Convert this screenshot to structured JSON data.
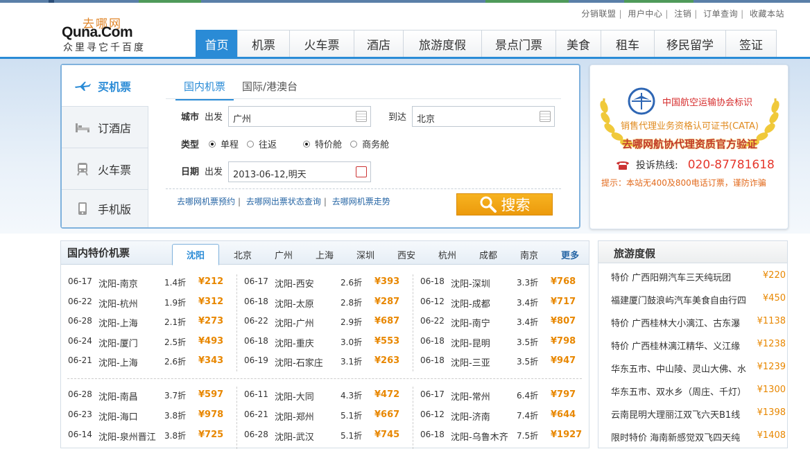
{
  "top_links": [
    "分销联盟",
    "用户中心",
    "注销",
    "订单查询",
    "收藏本站"
  ],
  "logo": {
    "cn": "去哪网",
    "en": "Quna.Com",
    "slogan": "众里寻它千百度"
  },
  "nav": [
    "首页",
    "机票",
    "火车票",
    "酒店",
    "旅游度假",
    "景点门票",
    "美食",
    "租车",
    "移民留学",
    "签证"
  ],
  "side_tabs": [
    {
      "label": "买机票",
      "icon": "airplane-icon"
    },
    {
      "label": "订酒店",
      "icon": "bed-icon"
    },
    {
      "label": "火车票",
      "icon": "train-icon"
    },
    {
      "label": "手机版",
      "icon": "mobile-icon"
    }
  ],
  "search": {
    "tabs": [
      "国内机票",
      "国际/港澳台"
    ],
    "city_label": "城市",
    "depart_label": "出发",
    "depart_value": "广州",
    "arrive_label": "到达",
    "arrive_value": "北京",
    "type_label": "类型",
    "trip_options": [
      "单程",
      "往返"
    ],
    "cabin_options": [
      "特价舱",
      "商务舱"
    ],
    "date_label": "日期",
    "date_depart_label": "出发",
    "date_value": "2013-06-12,明天",
    "quick_links": [
      "去哪网机票预约",
      "去哪网出票状态查询",
      "去哪网机票走势"
    ],
    "button": "搜索"
  },
  "cata": {
    "line1": "中国航空运输协会标识",
    "line2": "销售代理业务资格认可证书(CATA)",
    "line3": "去哪网航协代理资质官方验证",
    "hotline_label": "投诉热线:",
    "hotline_number": "020-87781618",
    "warning": "提示：本站无400及800电话订票，谨防诈骗"
  },
  "deals_panel": {
    "title": "国内特价机票",
    "cities": [
      "沈阳",
      "北京",
      "广州",
      "上海",
      "深圳",
      "西安",
      "杭州",
      "成都",
      "南京"
    ],
    "more": "更多",
    "columns": [
      [
        {
          "date": "06-17",
          "route": "沈阳-南京",
          "discount": "1.4折",
          "price": "¥212"
        },
        {
          "date": "06-22",
          "route": "沈阳-杭州",
          "discount": "1.9折",
          "price": "¥312"
        },
        {
          "date": "06-28",
          "route": "沈阳-上海",
          "discount": "2.1折",
          "price": "¥273"
        },
        {
          "date": "06-24",
          "route": "沈阳-厦门",
          "discount": "2.5折",
          "price": "¥493"
        },
        {
          "date": "06-21",
          "route": "沈阳-上海",
          "discount": "2.6折",
          "price": "¥343"
        },
        {
          "date": "06-28",
          "route": "沈阳-南昌",
          "discount": "3.7折",
          "price": "¥597"
        },
        {
          "date": "06-23",
          "route": "沈阳-海口",
          "discount": "3.8折",
          "price": "¥978"
        },
        {
          "date": "06-14",
          "route": "沈阳-泉州晋江",
          "discount": "3.8折",
          "price": "¥725"
        }
      ],
      [
        {
          "date": "06-17",
          "route": "沈阳-西安",
          "discount": "2.6折",
          "price": "¥393"
        },
        {
          "date": "06-18",
          "route": "沈阳-太原",
          "discount": "2.8折",
          "price": "¥287"
        },
        {
          "date": "06-22",
          "route": "沈阳-广州",
          "discount": "2.9折",
          "price": "¥687"
        },
        {
          "date": "06-18",
          "route": "沈阳-重庆",
          "discount": "3.0折",
          "price": "¥553"
        },
        {
          "date": "06-19",
          "route": "沈阳-石家庄",
          "discount": "3.1折",
          "price": "¥263"
        },
        {
          "date": "06-11",
          "route": "沈阳-大同",
          "discount": "4.3折",
          "price": "¥472"
        },
        {
          "date": "06-21",
          "route": "沈阳-郑州",
          "discount": "5.1折",
          "price": "¥667"
        },
        {
          "date": "06-28",
          "route": "沈阳-武汉",
          "discount": "5.1折",
          "price": "¥745"
        }
      ],
      [
        {
          "date": "06-18",
          "route": "沈阳-深圳",
          "discount": "3.3折",
          "price": "¥768"
        },
        {
          "date": "06-12",
          "route": "沈阳-成都",
          "discount": "3.4折",
          "price": "¥717"
        },
        {
          "date": "06-22",
          "route": "沈阳-南宁",
          "discount": "3.4折",
          "price": "¥807"
        },
        {
          "date": "06-18",
          "route": "沈阳-昆明",
          "discount": "3.5折",
          "price": "¥798"
        },
        {
          "date": "06-18",
          "route": "沈阳-三亚",
          "discount": "3.5折",
          "price": "¥947"
        },
        {
          "date": "06-17",
          "route": "沈阳-常州",
          "discount": "6.4折",
          "price": "¥797"
        },
        {
          "date": "06-12",
          "route": "沈阳-济南",
          "discount": "7.4折",
          "price": "¥644"
        },
        {
          "date": "06-18",
          "route": "沈阳-乌鲁木齐",
          "discount": "7.5折",
          "price": "¥1927"
        }
      ]
    ]
  },
  "travel": {
    "title": "旅游度假",
    "items": [
      {
        "name": "特价 广西阳朔汽车三天纯玩团",
        "price": "¥220"
      },
      {
        "name": "福建厦门鼓浪屿汽车美食自由行四",
        "price": "¥450"
      },
      {
        "name": "特价 广西桂林大小漓江、古东瀑",
        "price": "¥1138"
      },
      {
        "name": "特价 广西桂林漓江精华、义江缘",
        "price": "¥1238"
      },
      {
        "name": "华东五市、中山陵、灵山大佛、水",
        "price": "¥1239"
      },
      {
        "name": "华东五市、双水乡（周庄、千灯）",
        "price": "¥1300"
      },
      {
        "name": "云南昆明大理丽江双飞六天B1线",
        "price": "¥1398"
      },
      {
        "name": "限时特价 海南新感觉双飞四天纯",
        "price": "¥1408"
      }
    ]
  }
}
